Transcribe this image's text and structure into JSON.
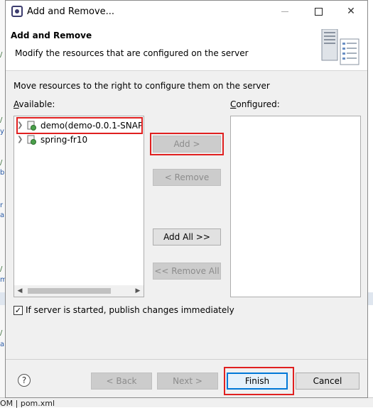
{
  "window": {
    "title": "Add and Remove...",
    "minimize_icon": "minimize-icon",
    "maximize_icon": "maximize-icon",
    "close_icon": "close-icon"
  },
  "header": {
    "title": "Add and Remove",
    "description": "Modify the resources that are configured on the server",
    "icon": "server-icon"
  },
  "body": {
    "instruction": "Move resources to the right to configure them on the server",
    "available_label": "Available:",
    "configured_label": "Configured:",
    "available_items": [
      {
        "label": "demo(demo-0.0.1-SNAP",
        "icon": "web-project-icon",
        "highlighted": true
      },
      {
        "label": "spring-fr10",
        "icon": "web-project-icon",
        "highlighted": false
      }
    ],
    "configured_items": []
  },
  "buttons": {
    "add": {
      "label": "Add >",
      "enabled": false
    },
    "remove": {
      "label": "< Remove",
      "enabled": false
    },
    "add_all": {
      "label": "Add All >>",
      "enabled": true
    },
    "remove_all": {
      "label": "<< Remove All",
      "enabled": false
    }
  },
  "publish_option": {
    "label": "If server is started, publish changes immediately",
    "checked": true
  },
  "footer": {
    "help_icon": "help-icon",
    "back": "< Back",
    "next": "Next >",
    "finish": "Finish",
    "cancel": "Cancel"
  },
  "background": {
    "status_tab": "OM | pom.xml"
  },
  "colors": {
    "highlight_red": "#e02020",
    "default_button_blue": "#0078d7",
    "dialog_bg": "#f0f0f0"
  }
}
